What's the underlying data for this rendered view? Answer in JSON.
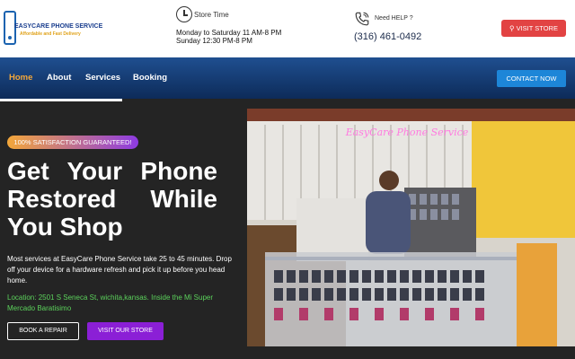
{
  "header": {
    "logo_name": "EASYCARE PHONE SERVICE",
    "logo_tagline": "Affordable and Fast Delivery",
    "store_time_label": "Store Time",
    "hours_line1": "Monday to Saturday 11 AM-8 PM",
    "hours_line2": "Sunday 12:30 PM-8 PM",
    "help_label": "Need HELP ?",
    "phone": "(316) 461-0492",
    "visit_store_label": "⚲ VISIT STORE"
  },
  "nav": {
    "items": [
      {
        "label": "Home",
        "active": true
      },
      {
        "label": "About",
        "active": false
      },
      {
        "label": "Services",
        "active": false
      },
      {
        "label": "Booking",
        "active": false
      }
    ],
    "contact_label": "CONTACT NOW"
  },
  "hero": {
    "badge": "100% SATISFACTION GUARANTEED!",
    "title_line1": "Get Your Phone",
    "title_line2": "Restored While",
    "title_line3": "You Shop",
    "description": "Most services at EasyCare Phone Service take 25 to 45 minutes. Drop off your device for a hardware refresh and pick it up before you head home.",
    "location": "Location: 2501 S Seneca St, wichita,kansas. Inside the Mi Super Mercado Baratisimo",
    "book_label": "BOOK A REPAIR",
    "visit_label": "VISIT OUR STORE",
    "photo_sign": "EasyCare Phone Service"
  },
  "colors": {
    "accent_orange": "#f3a73a",
    "visit_red": "#e24343",
    "contact_blue": "#1d86d8",
    "purple": "#8b1fd6",
    "location_green": "#5bd25b"
  }
}
